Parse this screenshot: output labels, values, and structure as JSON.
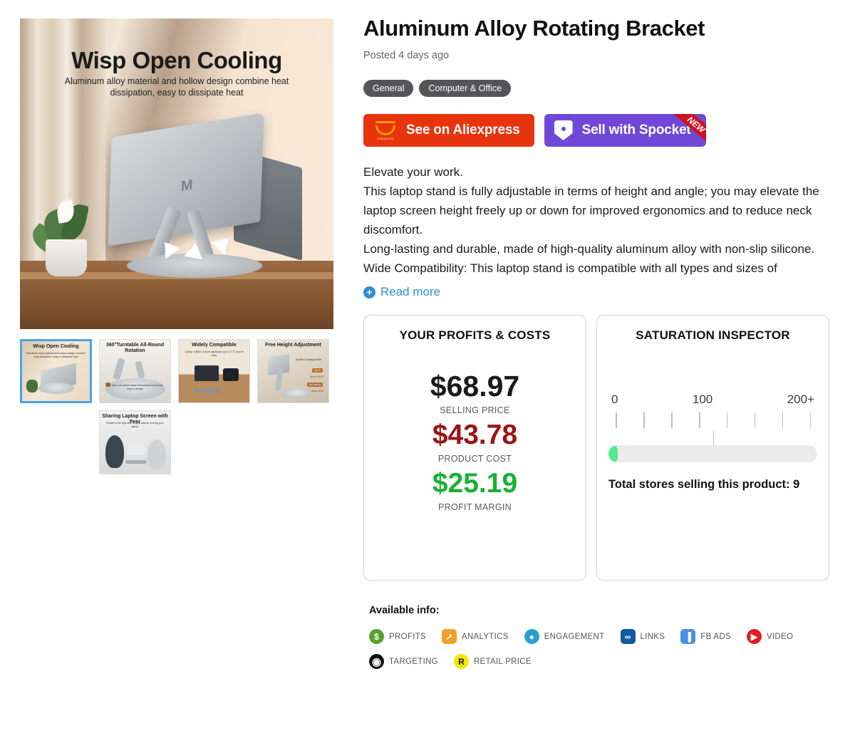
{
  "gallery": {
    "hero": {
      "title": "Wisp Open Cooling",
      "subtitle": "Aluminum alloy material and hollow design combine heat dissipation, easy to dissipate heat",
      "laptop_logo": "M"
    },
    "thumbnails": [
      {
        "caption": "Wisp Open Cooling",
        "subcaption": "Aluminum alloy material and hollow design combine heat dissipation, easy to dissipate heat",
        "selected": true
      },
      {
        "caption": "360°Turntable All-Round Rotation",
        "subcaption": "The base can stable adapt mechanical hard point, built-in design",
        "selected": false
      },
      {
        "caption": "Widely Compatible",
        "subcaption": "Laptop / tablet / phone appliance up to 17.3\" can be used",
        "selected": false
      },
      {
        "caption": "Free Height Adjustment",
        "subcaption": "Double Damping Shaft",
        "selected": false
      },
      {
        "caption": "Sharing Laptop Screen with Peer",
        "subcaption": "Rotate to the right line of sight without moving your laptop",
        "selected": false
      }
    ],
    "thumb4_badges": [
      "Up To",
      "About 29CM",
      "As Low As",
      "About 3CM"
    ]
  },
  "product": {
    "title": "Aluminum Alloy Rotating Bracket",
    "posted": "Posted 4 days ago",
    "tags": [
      "General",
      "Computer & Office"
    ],
    "buttons": {
      "aliexpress": {
        "label": "See on Aliexpress",
        "brand": "AliExpress",
        "color": "#e8340c"
      },
      "spocket": {
        "label": "Sell with Spocket",
        "ribbon": "NEW",
        "color": "#7048d8",
        "ribbon_color": "#cf1020"
      }
    },
    "description": [
      "Elevate your work.",
      "This laptop stand is fully adjustable in terms of height and angle; you may elevate the laptop screen height freely up or down for improved ergonomics and to reduce neck discomfort.",
      "Long-lasting and durable, made of high-quality aluminum alloy with non-slip silicone.",
      "Wide Compatibility: This laptop stand is compatible with all types and sizes of"
    ],
    "read_more": "Read more"
  },
  "profits_card": {
    "title": "YOUR PROFITS & COSTS",
    "metrics": [
      {
        "value": "$68.97",
        "label": "SELLING PRICE",
        "color": "#1a1a1a"
      },
      {
        "value": "$43.78",
        "label": "PRODUCT COST",
        "color": "#9b1414"
      },
      {
        "value": "$25.19",
        "label": "PROFIT MARGIN",
        "color": "#18b035"
      }
    ]
  },
  "saturation_card": {
    "title": "SATURATION INSPECTOR",
    "scale": {
      "min": "0",
      "mid": "100",
      "max": "200+"
    },
    "tick_count": 8,
    "marker_position_percent": 50,
    "fill_percent": 4.5,
    "fill_color": "#54eb8f",
    "total_text": "Total stores selling this product: 9",
    "total_stores": 9
  },
  "available_info": {
    "title": "Available info:",
    "rows": [
      [
        {
          "label": "PROFITS",
          "icon": "dollar-icon",
          "glyph": "$",
          "color": "#5aa02c",
          "shape": "circle"
        },
        {
          "label": "ANALYTICS",
          "icon": "chart-line-icon",
          "glyph": "↗",
          "color": "#f0a02a",
          "shape": "square"
        },
        {
          "label": "ENGAGEMENT",
          "icon": "person-icon",
          "glyph": "●",
          "color": "#2b9fce",
          "shape": "circle"
        },
        {
          "label": "LINKS",
          "icon": "link-icon",
          "glyph": "∞",
          "color": "#0e5aa0",
          "shape": "square"
        },
        {
          "label": "FB ADS",
          "icon": "bar-chart-icon",
          "glyph": "▐",
          "color": "#4a90e2",
          "shape": "square"
        },
        {
          "label": "VIDEO",
          "icon": "play-icon",
          "glyph": "▶",
          "color": "#e01b22",
          "shape": "circle"
        }
      ],
      [
        {
          "label": "TARGETING",
          "icon": "target-icon",
          "glyph": "◉",
          "color": "#111111",
          "shape": "circle"
        },
        {
          "label": "RETAIL PRICE",
          "icon": "retail-price-icon",
          "glyph": "R",
          "color": "#f5e800",
          "shape": "circle"
        }
      ]
    ]
  }
}
